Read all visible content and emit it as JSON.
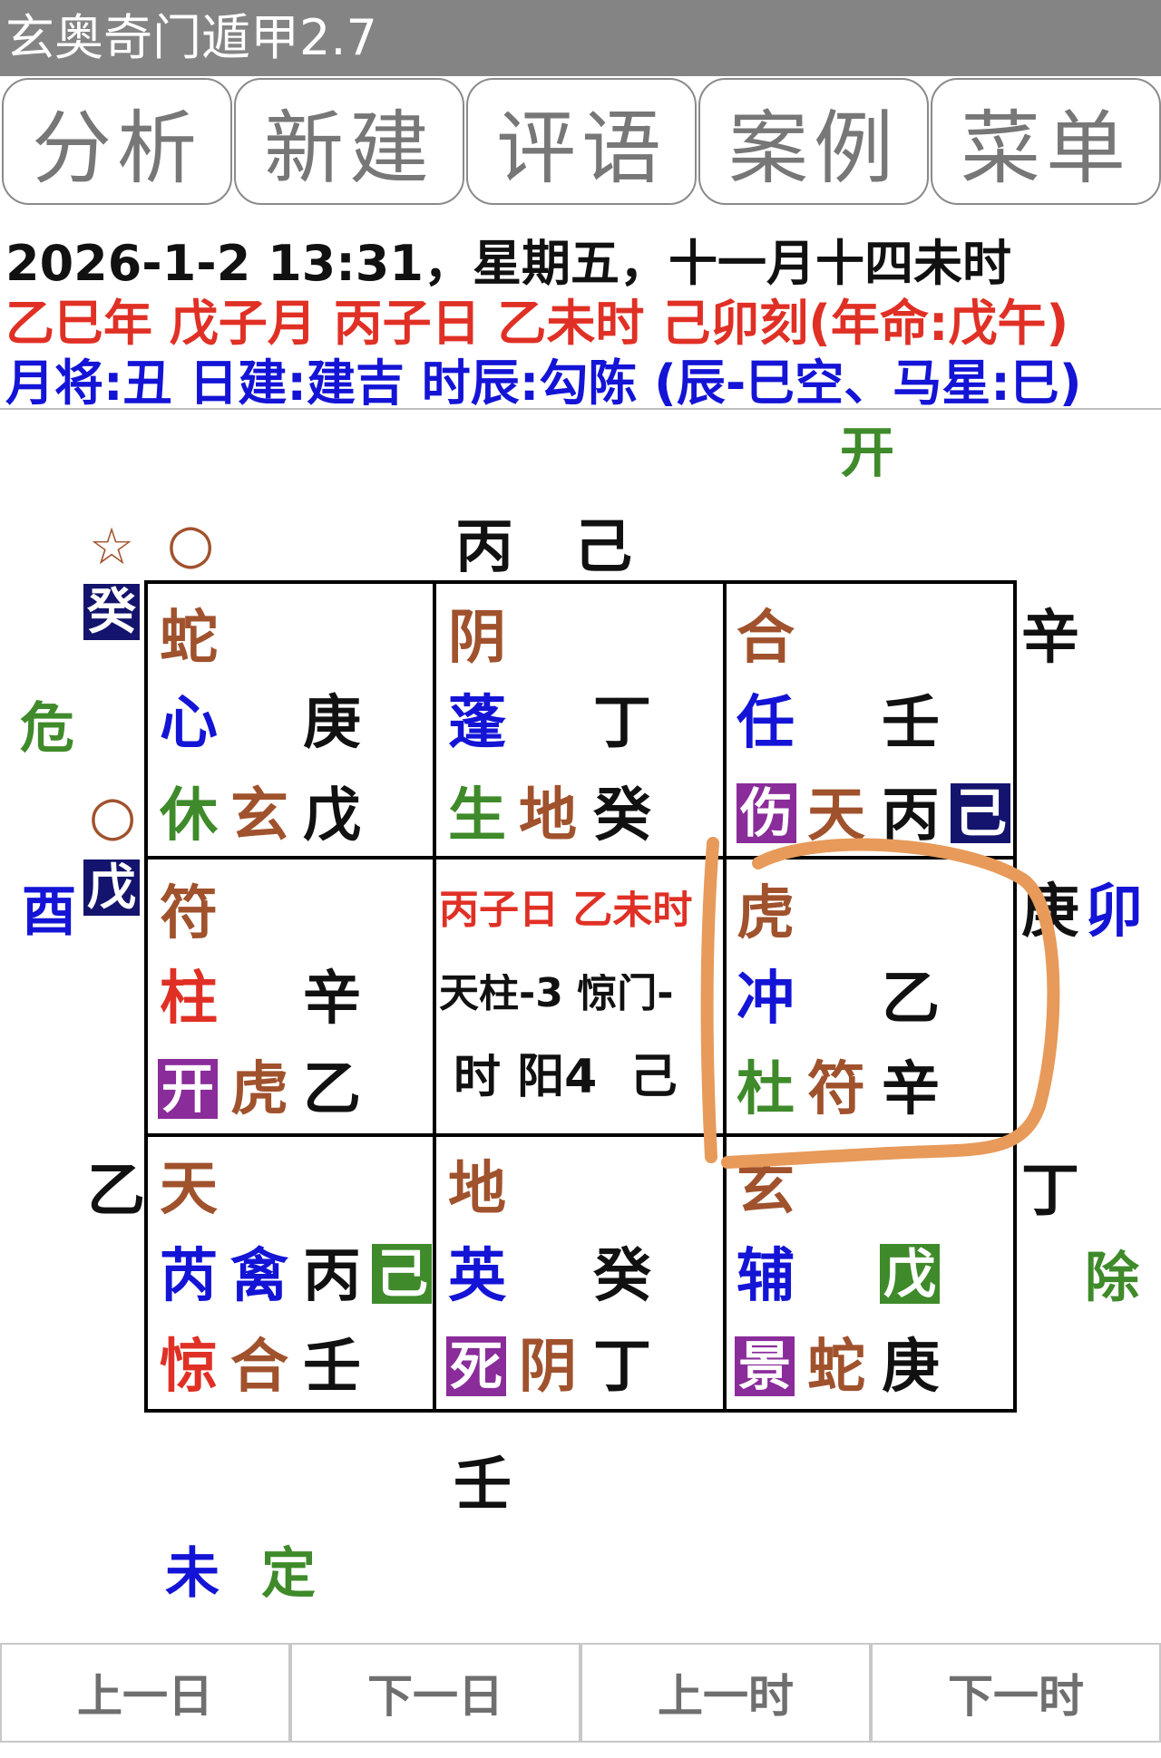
{
  "title": "玄奥奇门遁甲2.7",
  "tabs": [
    "分析",
    "新建",
    "评语",
    "案例",
    "菜单"
  ],
  "info": {
    "line1": "2026-1-2 13:31，星期五，十一月十四未时",
    "line2": "乙巳年  戊子月  丙子日  乙未时  己卯刻(年命:戊午)",
    "line3": "月将:丑 日建:建吉 时辰:勾陈 (辰-巳空、马星:巳)"
  },
  "outer": {
    "top_right_open": "开",
    "star_symbol": "☆",
    "circle_top": "○",
    "top_stems": "丙   己",
    "left_box_top": "癸",
    "danger": "危",
    "circle_left": "○",
    "left_box_mid": "戊",
    "you": "酉",
    "right_xin": "辛",
    "right_geng": "庚",
    "right_mao": "卯",
    "left_yi": "乙",
    "right_ding": "丁",
    "chu": "除",
    "bottom_ren": "壬",
    "wei": "未",
    "ding_settle": "定"
  },
  "palaces": {
    "nw": {
      "deity": "蛇",
      "star": "心",
      "heaven_stem": "庚",
      "door": "休",
      "lower_deity": "玄",
      "earth_stem": "戊"
    },
    "n": {
      "deity": "阴",
      "star": "蓬",
      "heaven_stem": "丁",
      "door": "生",
      "lower_deity": "地",
      "earth_stem": "癸"
    },
    "ne": {
      "deity": "合",
      "star": "任",
      "heaven_stem": "壬",
      "door": "伤",
      "lower_deity": "天",
      "earth_stem": "丙",
      "box_stem": "己"
    },
    "w": {
      "deity": "符",
      "star": "柱",
      "heaven_stem": "辛",
      "door": "开",
      "lower_deity": "虎",
      "earth_stem": "乙"
    },
    "center": {
      "line1": "丙子日 乙未时",
      "line2": "天柱-3 惊门-",
      "line3": "时 阳4  己"
    },
    "e": {
      "deity": "虎",
      "star": "冲",
      "heaven_stem": "乙",
      "door": "杜",
      "lower_deity": "符",
      "earth_stem": "辛"
    },
    "sw": {
      "deity": "天",
      "star": "芮",
      "star2": "禽",
      "heaven_stem": "丙",
      "box_stem": "己",
      "door": "惊",
      "lower_deity": "合",
      "earth_stem": "壬"
    },
    "s": {
      "deity": "地",
      "star": "英",
      "heaven_stem": "癸",
      "door": "死",
      "lower_deity": "阴",
      "earth_stem": "丁"
    },
    "se": {
      "deity": "玄",
      "star": "辅",
      "box_stem": "戊",
      "door": "景",
      "lower_deity": "蛇",
      "earth_stem": "庚"
    }
  },
  "nav": [
    "上一日",
    "下一日",
    "上一时",
    "下一时"
  ],
  "colors": {
    "titlebar": "#848484",
    "deity": "#a0522d",
    "star": "#1414d6",
    "door": "#3f8a2a",
    "door_box_purple": "#8a2c9a",
    "stem_box_navy": "#14146e",
    "stem_box_green": "#3f8a2a",
    "highlight": "#e79a5a"
  }
}
